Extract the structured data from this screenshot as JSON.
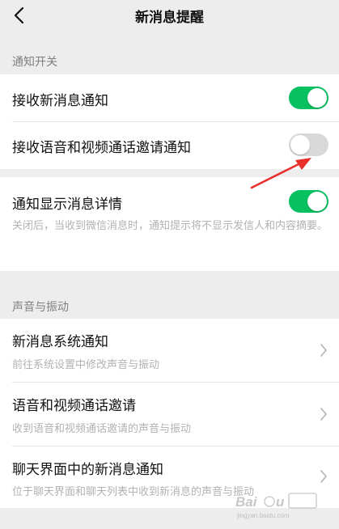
{
  "nav": {
    "title": "新消息提醒",
    "back_icon": "chevron-left-icon"
  },
  "sections": {
    "notify": {
      "header": "通知开关"
    },
    "sound": {
      "header": "声音与振动"
    }
  },
  "items": {
    "receive_new": {
      "label": "接收新消息通知",
      "state": "on"
    },
    "receive_voice_video": {
      "label": "接收语音和视频通话邀请通知",
      "state": "off"
    },
    "show_details": {
      "label": "通知显示消息详情",
      "state": "on",
      "description": "关闭后，当收到微信消息时，通知提示将不显示发信人和内容摘要。"
    },
    "system_notify": {
      "label": "新消息系统通知",
      "subtitle": "前往系统设置中修改声音与振动"
    },
    "voice_video_invite": {
      "label": "语音和视频通话邀请",
      "subtitle": "收到语音和视频通话邀请的声音与振动"
    },
    "chat_screen_notify": {
      "label": "聊天界面中的新消息通知",
      "subtitle": "位于聊天界面和聊天列表中收到新消息的声音与振动"
    }
  },
  "colors": {
    "accent": "#07c160",
    "toggle_off": "#d9d9d9",
    "annotation_arrow": "#e8302b"
  },
  "watermark": {
    "text": "Baidu经验",
    "sub": "jingyan.baidu.com"
  }
}
